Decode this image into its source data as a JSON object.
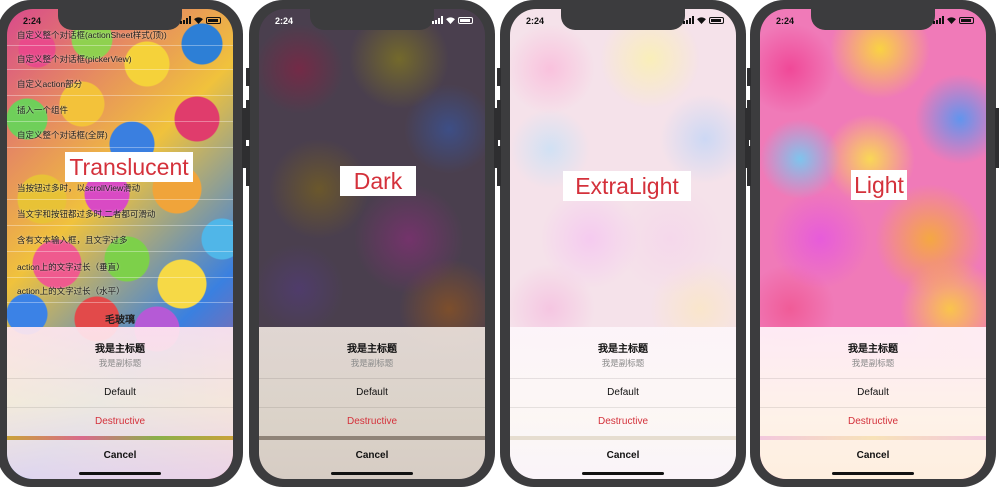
{
  "status_time": "2:24",
  "sheet": {
    "title": "我是主标题",
    "subtitle": "我是副标题",
    "default_label": "Default",
    "destructive_label": "Destructive",
    "cancel_label": "Cancel"
  },
  "colors": {
    "destructive": "#d4313b",
    "phone_frame": "#3c3c3e"
  },
  "phones": [
    {
      "blur_label": "Translucent",
      "menu_items": [
        "自定义整个对话框(actionSheet样式(顶))",
        "自定义整个对话框(pickerView)",
        "自定义action部分",
        "插入一个组件",
        "自定义整个对话框(全屏)",
        "当按钮过多时，以scrollView滑动",
        "当文字和按钮都过多时,二者都可滑动",
        "含有文本输入框，且文字过多",
        "action上的文字过长（垂直）",
        "action上的文字过长（水平）"
      ],
      "menu_section_title": "毛玻璃"
    },
    {
      "blur_label": "Dark"
    },
    {
      "blur_label": "ExtraLight"
    },
    {
      "blur_label": "Light"
    }
  ]
}
